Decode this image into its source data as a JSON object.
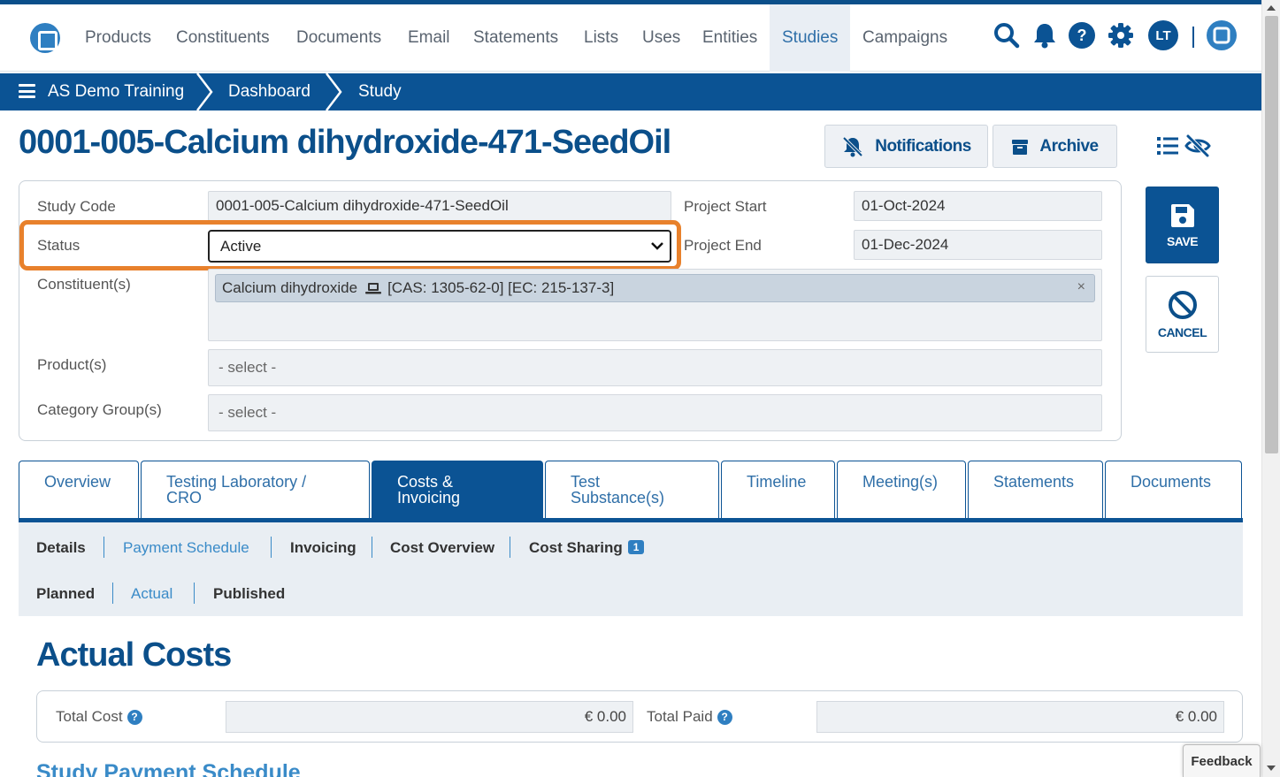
{
  "topnav": {
    "items": [
      "Products",
      "Constituents",
      "Documents",
      "Email",
      "Statements",
      "Lists",
      "Uses",
      "Entities",
      "Studies",
      "Campaigns"
    ],
    "active": "Studies",
    "help_glyph": "?",
    "avatar_initials": "LT",
    "icons": [
      "app-logo-icon",
      "search-icon",
      "bell-icon",
      "help-icon",
      "gear-icon",
      "user-avatar",
      "app-switch-icon"
    ]
  },
  "breadcrumb": {
    "items": [
      "AS Demo Training",
      "Dashboard",
      "Study"
    ]
  },
  "header": {
    "title": "0001-005-Calcium dihydroxide-471-SeedOil",
    "notifications_label": "Notifications",
    "archive_label": "Archive"
  },
  "form": {
    "study_code_label": "Study Code",
    "study_code_value": "0001-005-Calcium dihydroxide-471-SeedOil",
    "status_label": "Status",
    "status_value": "Active",
    "project_start_label": "Project Start",
    "project_start_value": "01-Oct-2024",
    "project_end_label": "Project End",
    "project_end_value": "01-Dec-2024",
    "constituents_label": "Constituent(s)",
    "constituent_name": "Calcium dihydroxide",
    "constituent_ids": "[CAS: 1305-62-0] [EC: 215-137-3]",
    "tag_remove": "×",
    "products_label": "Product(s)",
    "products_placeholder": "- select -",
    "category_groups_label": "Category Group(s)",
    "category_groups_placeholder": "- select -"
  },
  "actions": {
    "save_label": "SAVE",
    "cancel_label": "CANCEL"
  },
  "tabs": [
    {
      "line1": "Overview",
      "line2": ""
    },
    {
      "line1": "Testing Laboratory /",
      "line2": "CRO"
    },
    {
      "line1": "Costs &",
      "line2": "Invoicing"
    },
    {
      "line1": "Test",
      "line2": "Substance(s)"
    },
    {
      "line1": "Timeline",
      "line2": ""
    },
    {
      "line1": "Meeting(s)",
      "line2": ""
    },
    {
      "line1": "Statements",
      "line2": ""
    },
    {
      "line1": "Documents",
      "line2": ""
    }
  ],
  "active_tab": "Costs & Invoicing",
  "subnav": {
    "row1": [
      "Details",
      "Payment Schedule",
      "Invoicing",
      "Cost Overview",
      "Cost Sharing"
    ],
    "cost_sharing_badge": "1",
    "row2": [
      "Planned",
      "Actual",
      "Published"
    ]
  },
  "costs": {
    "title": "Actual Costs",
    "help_glyph": "?",
    "total_cost_label": "Total Cost",
    "total_cost_value": "€ 0.00",
    "total_paid_label": "Total Paid",
    "total_paid_value": "€ 0.00",
    "next_section_title": "Study Payment Schedule"
  },
  "feedback_label": "Feedback",
  "colors": {
    "brand": "#0b5394",
    "highlight": "#e8812c",
    "link": "#3a8bc8"
  }
}
